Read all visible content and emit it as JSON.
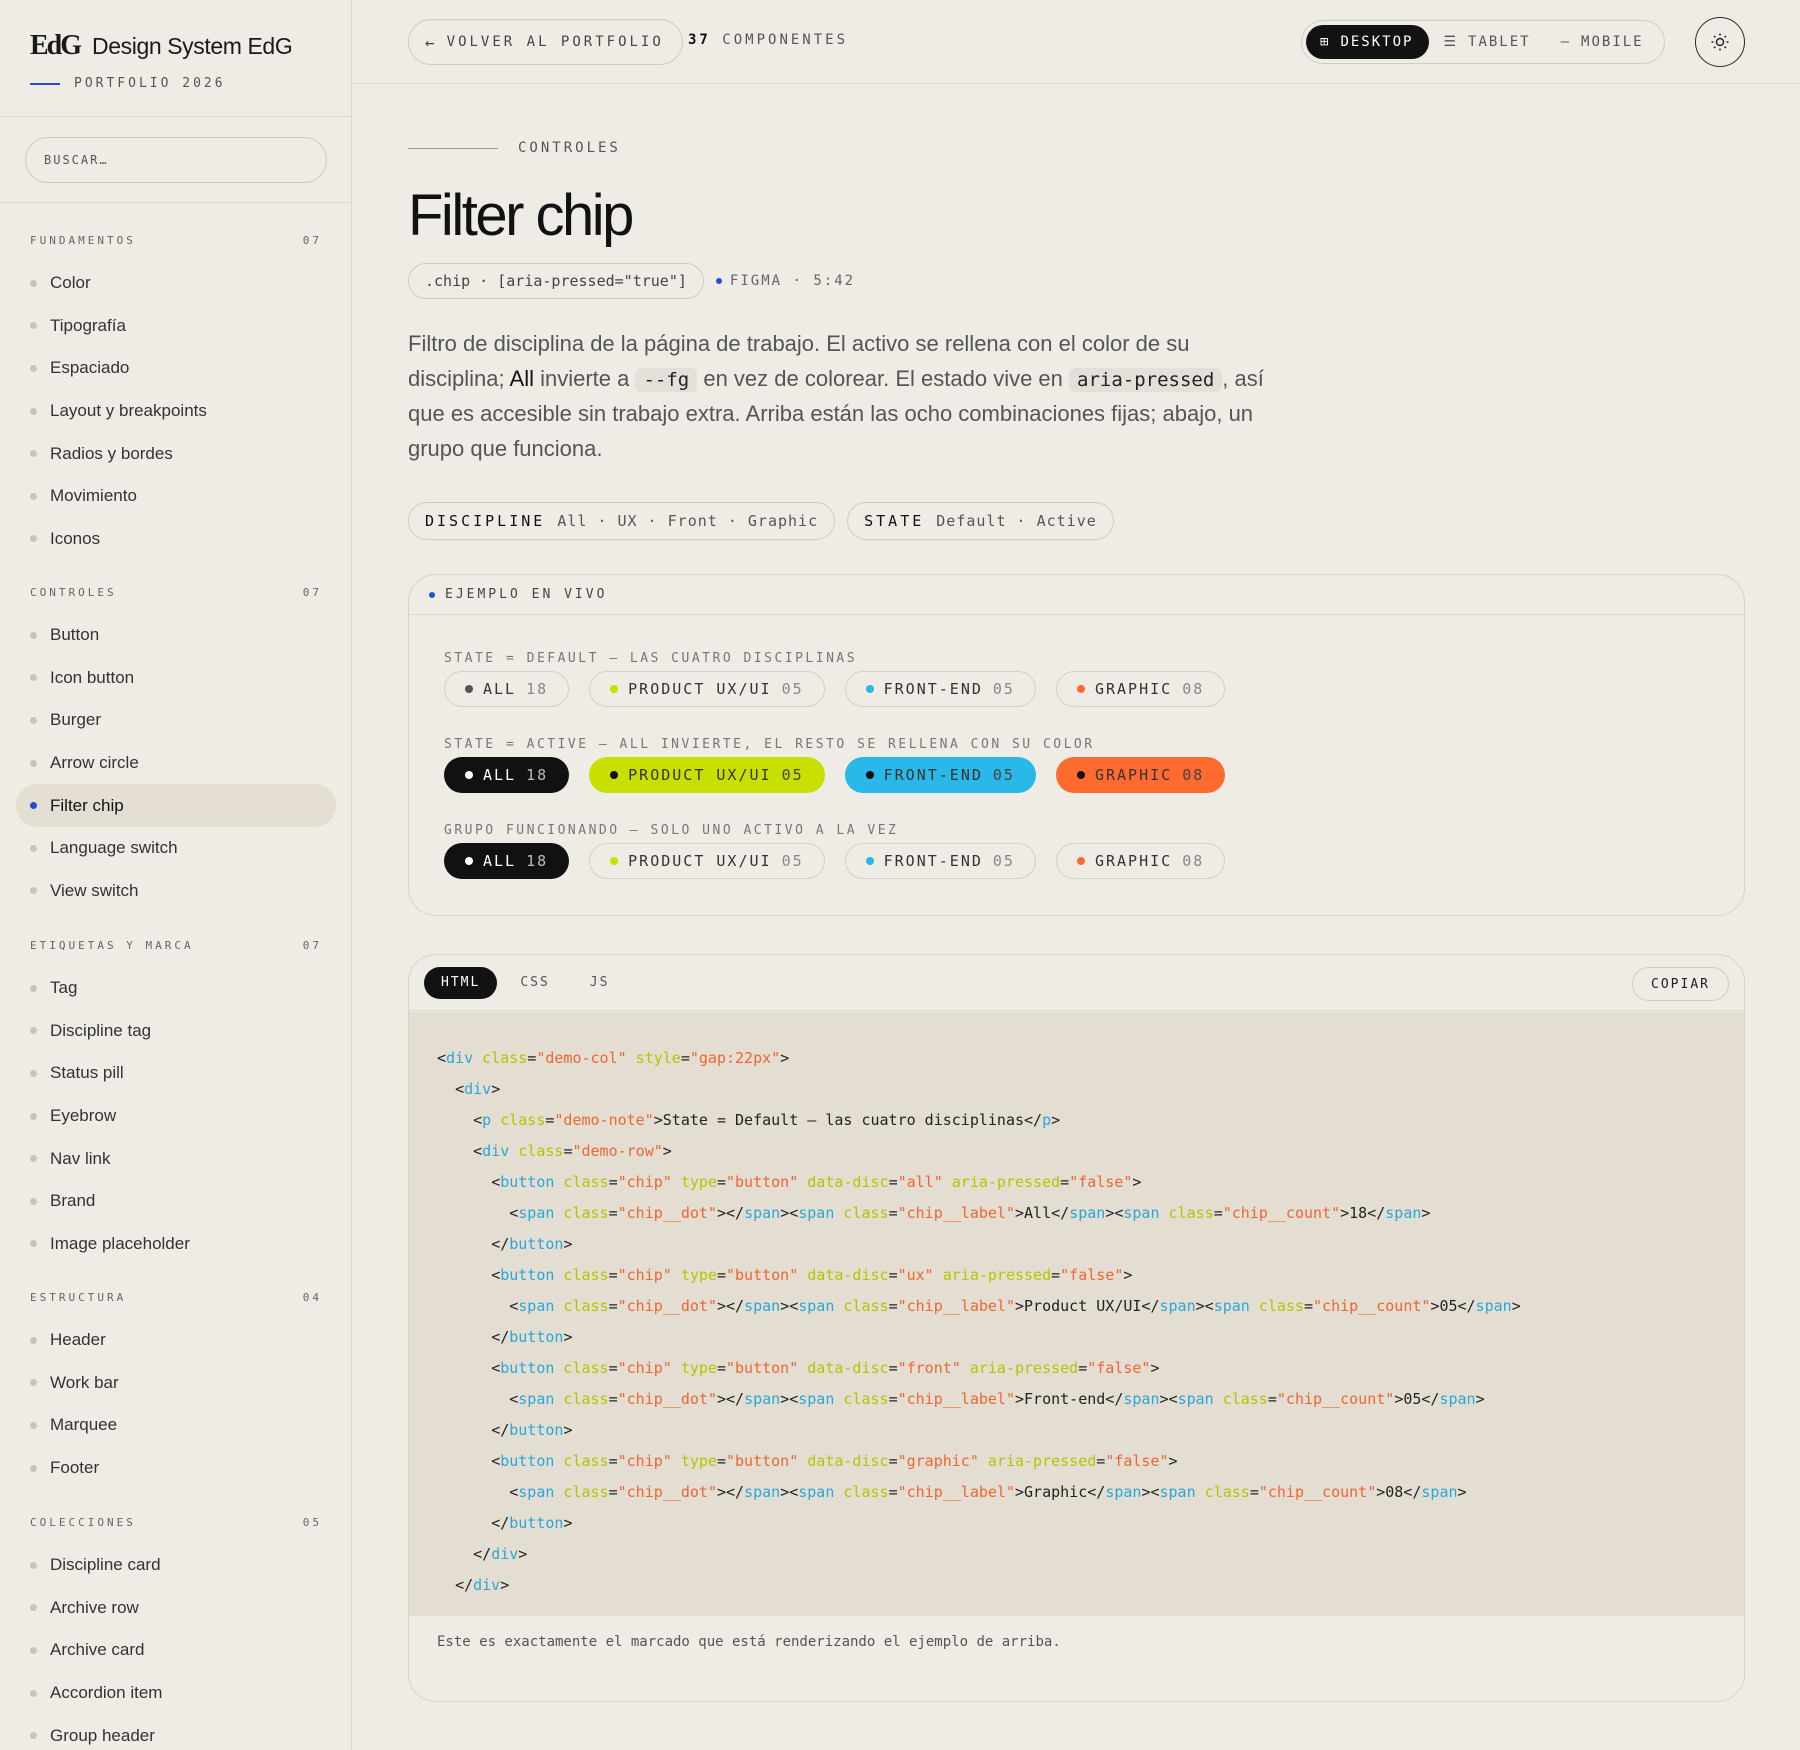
{
  "brand": {
    "logo": "EdG",
    "name": "Design System EdG",
    "sub": "PORTFOLIO 2026"
  },
  "search": {
    "placeholder": "BUSCAR…"
  },
  "nav": [
    {
      "title": "FUNDAMENTOS",
      "count": "07",
      "items": [
        "Color",
        "Tipografía",
        "Espaciado",
        "Layout y breakpoints",
        "Radios y bordes",
        "Movimiento",
        "Iconos"
      ]
    },
    {
      "title": "CONTROLES",
      "count": "07",
      "items": [
        "Button",
        "Icon button",
        "Burger",
        "Arrow circle",
        "Filter chip",
        "Language switch",
        "View switch"
      ]
    },
    {
      "title": "ETIQUETAS Y MARCA",
      "count": "07",
      "items": [
        "Tag",
        "Discipline tag",
        "Status pill",
        "Eyebrow",
        "Nav link",
        "Brand",
        "Image placeholder"
      ]
    },
    {
      "title": "ESTRUCTURA",
      "count": "04",
      "items": [
        "Header",
        "Work bar",
        "Marquee",
        "Footer"
      ]
    },
    {
      "title": "COLECCIONES",
      "count": "05",
      "items": [
        "Discipline card",
        "Archive row",
        "Archive card",
        "Accordion item",
        "Group header"
      ]
    }
  ],
  "active_nav": "Filter chip",
  "topbar": {
    "back_arrow": "←",
    "back_label": "VOLVER AL PORTFOLIO",
    "count_num": "37",
    "count_label": "COMPONENTES",
    "views": [
      {
        "label": "DESKTOP",
        "icon": "⊞",
        "active": true
      },
      {
        "label": "TABLET",
        "icon": "☰",
        "active": false
      },
      {
        "label": "MOBILE",
        "icon": "—",
        "active": false
      }
    ],
    "theme_icon": "sun-icon"
  },
  "page": {
    "eyebrow": "CONTROLES",
    "title": "Filter chip",
    "selector": ".chip · [aria-pressed=\"true\"]",
    "figma": "FIGMA · 5:42",
    "desc": {
      "p1": "Filtro de disciplina de la página de trabajo. El activo se rellena con el color de su disciplina; ",
      "all": "All",
      "p2": " invierte a ",
      "code1": "--fg",
      "p3": " en vez de colorear. El estado vive en ",
      "code2": "aria-pressed",
      "p4": ", así que es accesible sin trabajo extra. Arriba están las ocho combinaciones fijas; abajo, un grupo que funciona."
    },
    "props": [
      {
        "key": "DISCIPLINE",
        "values": "All · UX · Front · Graphic"
      },
      {
        "key": "STATE",
        "values": "Default · Active"
      }
    ]
  },
  "live": {
    "title": "EJEMPLO EN VIVO",
    "chips": [
      {
        "label": "ALL",
        "count": "18",
        "color": "#555555",
        "kind": "all"
      },
      {
        "label": "PRODUCT UX/UI",
        "count": "05",
        "color": "#c8e000",
        "kind": "ux"
      },
      {
        "label": "FRONT-END",
        "count": "05",
        "color": "#2ab8e8",
        "kind": "front"
      },
      {
        "label": "GRAPHIC",
        "count": "08",
        "color": "#ff6a2e",
        "kind": "graphic"
      }
    ],
    "sections": [
      {
        "note": "STATE = DEFAULT — LAS CUATRO DISCIPLINAS",
        "active": [
          false,
          false,
          false,
          false
        ]
      },
      {
        "note": "STATE = ACTIVE — ALL INVIERTE, EL RESTO SE RELLENA CON SU COLOR",
        "active": [
          true,
          true,
          true,
          true
        ]
      },
      {
        "note": "GRUPO FUNCIONANDO — SOLO UNO ACTIVO A LA VEZ",
        "active": [
          true,
          false,
          false,
          false
        ]
      }
    ]
  },
  "code": {
    "tabs": [
      "HTML",
      "CSS",
      "JS"
    ],
    "active_tab": "HTML",
    "copy": "COPIAR",
    "lines": [
      [
        [
          0,
          ""
        ],
        [
          1,
          "<"
        ],
        [
          2,
          "div"
        ],
        [
          3,
          " class"
        ],
        [
          1,
          "="
        ],
        [
          4,
          "\"demo-col\""
        ],
        [
          3,
          " style"
        ],
        [
          1,
          "="
        ],
        [
          4,
          "\"gap:22px\""
        ],
        [
          1,
          ">"
        ]
      ],
      [
        [
          0,
          "  "
        ],
        [
          1,
          "<"
        ],
        [
          2,
          "div"
        ],
        [
          1,
          ">"
        ]
      ],
      [
        [
          0,
          "    "
        ],
        [
          1,
          "<"
        ],
        [
          2,
          "p"
        ],
        [
          3,
          " class"
        ],
        [
          1,
          "="
        ],
        [
          4,
          "\"demo-note\""
        ],
        [
          1,
          ">State = Default — las cuatro disciplinas</"
        ],
        [
          2,
          "p"
        ],
        [
          1,
          ">"
        ]
      ],
      [
        [
          0,
          "    "
        ],
        [
          1,
          "<"
        ],
        [
          2,
          "div"
        ],
        [
          3,
          " class"
        ],
        [
          1,
          "="
        ],
        [
          4,
          "\"demo-row\""
        ],
        [
          1,
          ">"
        ]
      ],
      [
        [
          0,
          "      "
        ],
        [
          1,
          "<"
        ],
        [
          2,
          "button"
        ],
        [
          3,
          " class"
        ],
        [
          1,
          "="
        ],
        [
          4,
          "\"chip\""
        ],
        [
          3,
          " type"
        ],
        [
          1,
          "="
        ],
        [
          4,
          "\"button\""
        ],
        [
          3,
          " data-disc"
        ],
        [
          1,
          "="
        ],
        [
          4,
          "\"all\""
        ],
        [
          3,
          " aria-pressed"
        ],
        [
          1,
          "="
        ],
        [
          4,
          "\"false\""
        ],
        [
          1,
          ">"
        ]
      ],
      [
        [
          0,
          "        "
        ],
        [
          1,
          "<"
        ],
        [
          2,
          "span"
        ],
        [
          3,
          " class"
        ],
        [
          1,
          "="
        ],
        [
          4,
          "\"chip__dot\""
        ],
        [
          1,
          "></"
        ],
        [
          2,
          "span"
        ],
        [
          1,
          "><"
        ],
        [
          2,
          "span"
        ],
        [
          3,
          " class"
        ],
        [
          1,
          "="
        ],
        [
          4,
          "\"chip__label\""
        ],
        [
          1,
          ">All</"
        ],
        [
          2,
          "span"
        ],
        [
          1,
          "><"
        ],
        [
          2,
          "span"
        ],
        [
          3,
          " class"
        ],
        [
          1,
          "="
        ],
        [
          4,
          "\"chip__count\""
        ],
        [
          1,
          ">18</"
        ],
        [
          2,
          "span"
        ],
        [
          1,
          ">"
        ]
      ],
      [
        [
          0,
          "      "
        ],
        [
          1,
          "</"
        ],
        [
          2,
          "button"
        ],
        [
          1,
          ">"
        ]
      ],
      [
        [
          0,
          "      "
        ],
        [
          1,
          "<"
        ],
        [
          2,
          "button"
        ],
        [
          3,
          " class"
        ],
        [
          1,
          "="
        ],
        [
          4,
          "\"chip\""
        ],
        [
          3,
          " type"
        ],
        [
          1,
          "="
        ],
        [
          4,
          "\"button\""
        ],
        [
          3,
          " data-disc"
        ],
        [
          1,
          "="
        ],
        [
          4,
          "\"ux\""
        ],
        [
          3,
          " aria-pressed"
        ],
        [
          1,
          "="
        ],
        [
          4,
          "\"false\""
        ],
        [
          1,
          ">"
        ]
      ],
      [
        [
          0,
          "        "
        ],
        [
          1,
          "<"
        ],
        [
          2,
          "span"
        ],
        [
          3,
          " class"
        ],
        [
          1,
          "="
        ],
        [
          4,
          "\"chip__dot\""
        ],
        [
          1,
          "></"
        ],
        [
          2,
          "span"
        ],
        [
          1,
          "><"
        ],
        [
          2,
          "span"
        ],
        [
          3,
          " class"
        ],
        [
          1,
          "="
        ],
        [
          4,
          "\"chip__label\""
        ],
        [
          1,
          ">Product UX/UI</"
        ],
        [
          2,
          "span"
        ],
        [
          1,
          "><"
        ],
        [
          2,
          "span"
        ],
        [
          3,
          " class"
        ],
        [
          1,
          "="
        ],
        [
          4,
          "\"chip__count\""
        ],
        [
          1,
          ">05</"
        ],
        [
          2,
          "span"
        ],
        [
          1,
          ">"
        ]
      ],
      [
        [
          0,
          "      "
        ],
        [
          1,
          "</"
        ],
        [
          2,
          "button"
        ],
        [
          1,
          ">"
        ]
      ],
      [
        [
          0,
          "      "
        ],
        [
          1,
          "<"
        ],
        [
          2,
          "button"
        ],
        [
          3,
          " class"
        ],
        [
          1,
          "="
        ],
        [
          4,
          "\"chip\""
        ],
        [
          3,
          " type"
        ],
        [
          1,
          "="
        ],
        [
          4,
          "\"button\""
        ],
        [
          3,
          " data-disc"
        ],
        [
          1,
          "="
        ],
        [
          4,
          "\"front\""
        ],
        [
          3,
          " aria-pressed"
        ],
        [
          1,
          "="
        ],
        [
          4,
          "\"false\""
        ],
        [
          1,
          ">"
        ]
      ],
      [
        [
          0,
          "        "
        ],
        [
          1,
          "<"
        ],
        [
          2,
          "span"
        ],
        [
          3,
          " class"
        ],
        [
          1,
          "="
        ],
        [
          4,
          "\"chip__dot\""
        ],
        [
          1,
          "></"
        ],
        [
          2,
          "span"
        ],
        [
          1,
          "><"
        ],
        [
          2,
          "span"
        ],
        [
          3,
          " class"
        ],
        [
          1,
          "="
        ],
        [
          4,
          "\"chip__label\""
        ],
        [
          1,
          ">Front-end</"
        ],
        [
          2,
          "span"
        ],
        [
          1,
          "><"
        ],
        [
          2,
          "span"
        ],
        [
          3,
          " class"
        ],
        [
          1,
          "="
        ],
        [
          4,
          "\"chip__count\""
        ],
        [
          1,
          ">05</"
        ],
        [
          2,
          "span"
        ],
        [
          1,
          ">"
        ]
      ],
      [
        [
          0,
          "      "
        ],
        [
          1,
          "</"
        ],
        [
          2,
          "button"
        ],
        [
          1,
          ">"
        ]
      ],
      [
        [
          0,
          "      "
        ],
        [
          1,
          "<"
        ],
        [
          2,
          "button"
        ],
        [
          3,
          " class"
        ],
        [
          1,
          "="
        ],
        [
          4,
          "\"chip\""
        ],
        [
          3,
          " type"
        ],
        [
          1,
          "="
        ],
        [
          4,
          "\"button\""
        ],
        [
          3,
          " data-disc"
        ],
        [
          1,
          "="
        ],
        [
          4,
          "\"graphic\""
        ],
        [
          3,
          " aria-pressed"
        ],
        [
          1,
          "="
        ],
        [
          4,
          "\"false\""
        ],
        [
          1,
          ">"
        ]
      ],
      [
        [
          0,
          "        "
        ],
        [
          1,
          "<"
        ],
        [
          2,
          "span"
        ],
        [
          3,
          " class"
        ],
        [
          1,
          "="
        ],
        [
          4,
          "\"chip__dot\""
        ],
        [
          1,
          "></"
        ],
        [
          2,
          "span"
        ],
        [
          1,
          "><"
        ],
        [
          2,
          "span"
        ],
        [
          3,
          " class"
        ],
        [
          1,
          "="
        ],
        [
          4,
          "\"chip__label\""
        ],
        [
          1,
          ">Graphic</"
        ],
        [
          2,
          "span"
        ],
        [
          1,
          "><"
        ],
        [
          2,
          "span"
        ],
        [
          3,
          " class"
        ],
        [
          1,
          "="
        ],
        [
          4,
          "\"chip__count\""
        ],
        [
          1,
          ">08</"
        ],
        [
          2,
          "span"
        ],
        [
          1,
          ">"
        ]
      ],
      [
        [
          0,
          "      "
        ],
        [
          1,
          "</"
        ],
        [
          2,
          "button"
        ],
        [
          1,
          ">"
        ]
      ],
      [
        [
          0,
          "    "
        ],
        [
          1,
          "</"
        ],
        [
          2,
          "div"
        ],
        [
          1,
          ">"
        ]
      ],
      [
        [
          0,
          "  "
        ],
        [
          1,
          "</"
        ],
        [
          2,
          "div"
        ],
        [
          1,
          ">"
        ]
      ]
    ],
    "footer": "Este es exactamente el marcado que está renderizando el ejemplo de arriba."
  },
  "colors": {
    "accent": "#2a4bd8",
    "all": "#121212",
    "ux": "#c8e000",
    "front": "#2ab8e8",
    "graphic": "#ff6a2e"
  }
}
